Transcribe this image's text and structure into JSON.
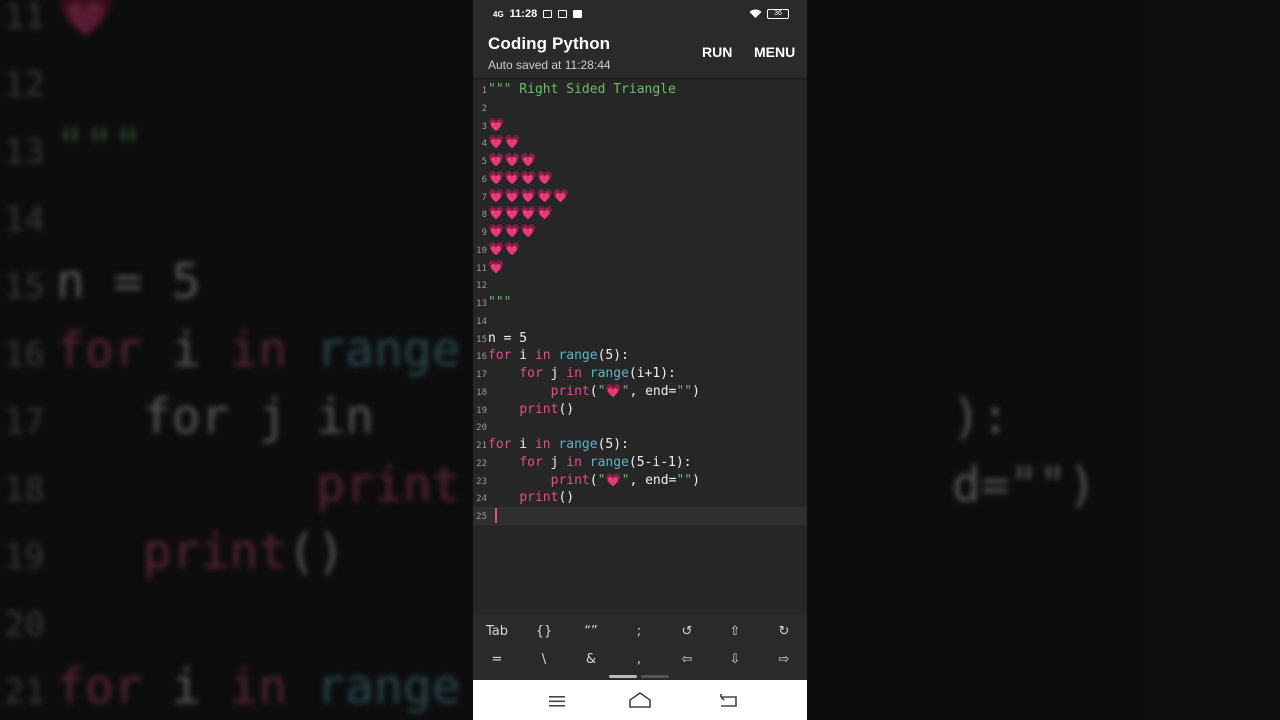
{
  "status": {
    "network": "4G",
    "time": "11:28",
    "battery": "36"
  },
  "app": {
    "title": "Coding Python",
    "subtitle": "Auto saved at 11:28:44",
    "run_label": "RUN",
    "menu_label": "MENU"
  },
  "colors": {
    "keyword": "#e0508f",
    "function": "#5fb3c7",
    "string": "#6dbd6a",
    "heart": "#e0508f"
  },
  "editor": {
    "lines": [
      {
        "n": "1",
        "code": [
          [
            "\"\"\" Right Sided Triangle",
            "st"
          ]
        ]
      },
      {
        "n": "2",
        "code": []
      },
      {
        "n": "3",
        "code": [
          [
            "💗",
            "heart"
          ]
        ]
      },
      {
        "n": "4",
        "code": [
          [
            "💗💗",
            "heart"
          ]
        ]
      },
      {
        "n": "5",
        "code": [
          [
            "💗💗💗",
            "heart"
          ]
        ]
      },
      {
        "n": "6",
        "code": [
          [
            "💗💗💗💗",
            "heart"
          ]
        ]
      },
      {
        "n": "7",
        "code": [
          [
            "💗💗💗💗💗",
            "heart"
          ]
        ]
      },
      {
        "n": "8",
        "code": [
          [
            "💗💗💗💗",
            "heart"
          ]
        ]
      },
      {
        "n": "9",
        "code": [
          [
            "💗💗💗",
            "heart"
          ]
        ]
      },
      {
        "n": "10",
        "code": [
          [
            "💗💗",
            "heart"
          ]
        ]
      },
      {
        "n": "11",
        "code": [
          [
            "💗",
            "heart"
          ]
        ]
      },
      {
        "n": "12",
        "code": []
      },
      {
        "n": "13",
        "code": [
          [
            "\"\"\"",
            "st"
          ]
        ]
      },
      {
        "n": "14",
        "code": []
      },
      {
        "n": "15",
        "code": [
          [
            "n = 5",
            "wt"
          ]
        ]
      },
      {
        "n": "16",
        "code": [
          [
            "for",
            "kw"
          ],
          [
            " i ",
            "wt"
          ],
          [
            "in",
            "kw"
          ],
          [
            " ",
            "wt"
          ],
          [
            "range",
            "fn"
          ],
          [
            "(5):",
            "wt"
          ]
        ]
      },
      {
        "n": "17",
        "code": [
          [
            "    ",
            "wt"
          ],
          [
            "for",
            "kw"
          ],
          [
            " j ",
            "wt"
          ],
          [
            "in",
            "kw"
          ],
          [
            " ",
            "wt"
          ],
          [
            "range",
            "fn"
          ],
          [
            "(i+1):",
            "wt"
          ]
        ]
      },
      {
        "n": "18",
        "code": [
          [
            "        ",
            "wt"
          ],
          [
            "print",
            "kw"
          ],
          [
            "(",
            "wt"
          ],
          [
            "\"💗\"",
            "st"
          ],
          [
            ", end=",
            "wt"
          ],
          [
            "\"\"",
            "st"
          ],
          [
            ")",
            "wt"
          ]
        ]
      },
      {
        "n": "19",
        "code": [
          [
            "    ",
            "wt"
          ],
          [
            "print",
            "kw"
          ],
          [
            "()",
            "wt"
          ]
        ]
      },
      {
        "n": "20",
        "code": []
      },
      {
        "n": "21",
        "code": [
          [
            "for",
            "kw"
          ],
          [
            " i ",
            "wt"
          ],
          [
            "in",
            "kw"
          ],
          [
            " ",
            "wt"
          ],
          [
            "range",
            "fn"
          ],
          [
            "(5):",
            "wt"
          ]
        ]
      },
      {
        "n": "22",
        "code": [
          [
            "    ",
            "wt"
          ],
          [
            "for",
            "kw"
          ],
          [
            " j ",
            "wt"
          ],
          [
            "in",
            "kw"
          ],
          [
            " ",
            "wt"
          ],
          [
            "range",
            "fn"
          ],
          [
            "(5-i-1):",
            "wt"
          ]
        ]
      },
      {
        "n": "23",
        "code": [
          [
            "        ",
            "wt"
          ],
          [
            "print",
            "kw"
          ],
          [
            "(",
            "wt"
          ],
          [
            "\"💗\"",
            "st"
          ],
          [
            ", end=",
            "wt"
          ],
          [
            "\"\"",
            "st"
          ],
          [
            ")",
            "wt"
          ]
        ]
      },
      {
        "n": "24",
        "code": [
          [
            "    ",
            "wt"
          ],
          [
            "print",
            "kw"
          ],
          [
            "()",
            "wt"
          ]
        ]
      },
      {
        "n": "25",
        "code": []
      }
    ],
    "current_line": "25"
  },
  "keyboard_row1": [
    "Tab",
    "{}",
    "“”",
    ";",
    "↺",
    "⇧",
    "↻"
  ],
  "keyboard_row2": [
    "=",
    "\\",
    "&",
    ",",
    "⇦",
    "⇩",
    "⇨"
  ],
  "background": {
    "lines": [
      {
        "n": "11",
        "code": [
          [
            "💗",
            "heart"
          ]
        ]
      },
      {
        "n": "12",
        "code": []
      },
      {
        "n": "13",
        "code": [
          [
            "\"\"\"",
            "st"
          ]
        ]
      },
      {
        "n": "14",
        "code": []
      },
      {
        "n": "15",
        "code": [
          [
            "n = 5",
            "wt"
          ]
        ]
      },
      {
        "n": "16",
        "code": [
          [
            "for",
            "kw"
          ],
          [
            " i ",
            "wt"
          ],
          [
            "in",
            "kw"
          ],
          [
            " ",
            "wt"
          ],
          [
            "range",
            "fn"
          ]
        ]
      },
      {
        "n": "17",
        "code": [
          [
            "   for j in",
            "wt"
          ],
          [
            "                    ):",
            "wt"
          ]
        ]
      },
      {
        "n": "18",
        "code": [
          [
            "         print",
            "kw"
          ],
          [
            "                 d=\"\")",
            "wt"
          ]
        ]
      },
      {
        "n": "19",
        "code": [
          [
            "   ",
            "wt"
          ],
          [
            "print",
            "kw"
          ],
          [
            "()",
            "wt"
          ]
        ]
      },
      {
        "n": "20",
        "code": []
      },
      {
        "n": "21",
        "code": [
          [
            "for",
            "kw"
          ],
          [
            " i ",
            "wt"
          ],
          [
            "in",
            "kw"
          ],
          [
            " ",
            "wt"
          ],
          [
            "range",
            "fn"
          ]
        ]
      }
    ]
  }
}
